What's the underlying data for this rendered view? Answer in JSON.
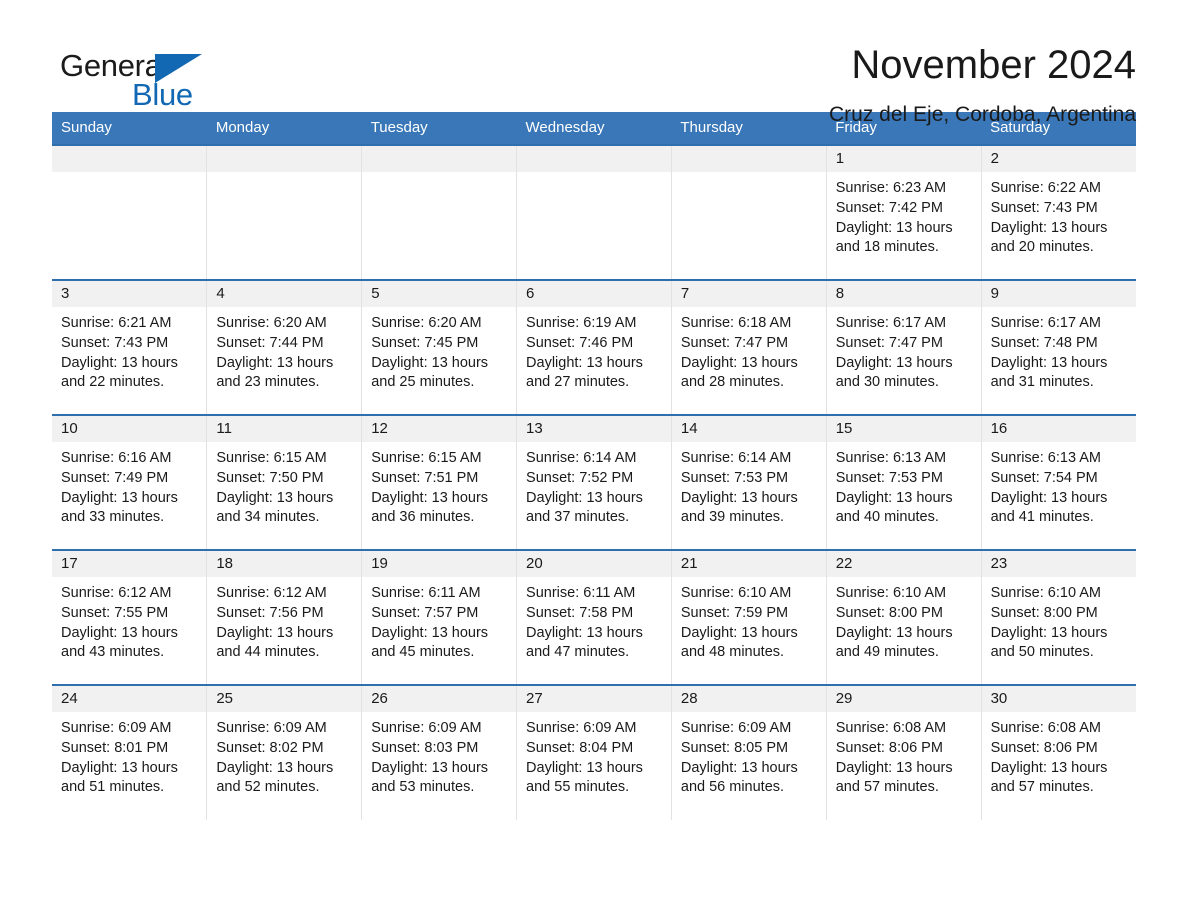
{
  "brand": {
    "name_part1": "General",
    "name_part2": "Blue",
    "accent_color": "#1268b3"
  },
  "header": {
    "month_title": "November 2024",
    "location": "Cruz del Eje, Cordoba, Argentina"
  },
  "calendar": {
    "header_bg": "#3a77b8",
    "row_divider_color": "#2f6fad",
    "weekdays": [
      "Sunday",
      "Monday",
      "Tuesday",
      "Wednesday",
      "Thursday",
      "Friday",
      "Saturday"
    ],
    "weeks": [
      [
        {
          "day": "",
          "lines": []
        },
        {
          "day": "",
          "lines": []
        },
        {
          "day": "",
          "lines": []
        },
        {
          "day": "",
          "lines": []
        },
        {
          "day": "",
          "lines": []
        },
        {
          "day": "1",
          "lines": [
            "Sunrise: 6:23 AM",
            "Sunset: 7:42 PM",
            "Daylight: 13 hours",
            "and 18 minutes."
          ]
        },
        {
          "day": "2",
          "lines": [
            "Sunrise: 6:22 AM",
            "Sunset: 7:43 PM",
            "Daylight: 13 hours",
            "and 20 minutes."
          ]
        }
      ],
      [
        {
          "day": "3",
          "lines": [
            "Sunrise: 6:21 AM",
            "Sunset: 7:43 PM",
            "Daylight: 13 hours",
            "and 22 minutes."
          ]
        },
        {
          "day": "4",
          "lines": [
            "Sunrise: 6:20 AM",
            "Sunset: 7:44 PM",
            "Daylight: 13 hours",
            "and 23 minutes."
          ]
        },
        {
          "day": "5",
          "lines": [
            "Sunrise: 6:20 AM",
            "Sunset: 7:45 PM",
            "Daylight: 13 hours",
            "and 25 minutes."
          ]
        },
        {
          "day": "6",
          "lines": [
            "Sunrise: 6:19 AM",
            "Sunset: 7:46 PM",
            "Daylight: 13 hours",
            "and 27 minutes."
          ]
        },
        {
          "day": "7",
          "lines": [
            "Sunrise: 6:18 AM",
            "Sunset: 7:47 PM",
            "Daylight: 13 hours",
            "and 28 minutes."
          ]
        },
        {
          "day": "8",
          "lines": [
            "Sunrise: 6:17 AM",
            "Sunset: 7:47 PM",
            "Daylight: 13 hours",
            "and 30 minutes."
          ]
        },
        {
          "day": "9",
          "lines": [
            "Sunrise: 6:17 AM",
            "Sunset: 7:48 PM",
            "Daylight: 13 hours",
            "and 31 minutes."
          ]
        }
      ],
      [
        {
          "day": "10",
          "lines": [
            "Sunrise: 6:16 AM",
            "Sunset: 7:49 PM",
            "Daylight: 13 hours",
            "and 33 minutes."
          ]
        },
        {
          "day": "11",
          "lines": [
            "Sunrise: 6:15 AM",
            "Sunset: 7:50 PM",
            "Daylight: 13 hours",
            "and 34 minutes."
          ]
        },
        {
          "day": "12",
          "lines": [
            "Sunrise: 6:15 AM",
            "Sunset: 7:51 PM",
            "Daylight: 13 hours",
            "and 36 minutes."
          ]
        },
        {
          "day": "13",
          "lines": [
            "Sunrise: 6:14 AM",
            "Sunset: 7:52 PM",
            "Daylight: 13 hours",
            "and 37 minutes."
          ]
        },
        {
          "day": "14",
          "lines": [
            "Sunrise: 6:14 AM",
            "Sunset: 7:53 PM",
            "Daylight: 13 hours",
            "and 39 minutes."
          ]
        },
        {
          "day": "15",
          "lines": [
            "Sunrise: 6:13 AM",
            "Sunset: 7:53 PM",
            "Daylight: 13 hours",
            "and 40 minutes."
          ]
        },
        {
          "day": "16",
          "lines": [
            "Sunrise: 6:13 AM",
            "Sunset: 7:54 PM",
            "Daylight: 13 hours",
            "and 41 minutes."
          ]
        }
      ],
      [
        {
          "day": "17",
          "lines": [
            "Sunrise: 6:12 AM",
            "Sunset: 7:55 PM",
            "Daylight: 13 hours",
            "and 43 minutes."
          ]
        },
        {
          "day": "18",
          "lines": [
            "Sunrise: 6:12 AM",
            "Sunset: 7:56 PM",
            "Daylight: 13 hours",
            "and 44 minutes."
          ]
        },
        {
          "day": "19",
          "lines": [
            "Sunrise: 6:11 AM",
            "Sunset: 7:57 PM",
            "Daylight: 13 hours",
            "and 45 minutes."
          ]
        },
        {
          "day": "20",
          "lines": [
            "Sunrise: 6:11 AM",
            "Sunset: 7:58 PM",
            "Daylight: 13 hours",
            "and 47 minutes."
          ]
        },
        {
          "day": "21",
          "lines": [
            "Sunrise: 6:10 AM",
            "Sunset: 7:59 PM",
            "Daylight: 13 hours",
            "and 48 minutes."
          ]
        },
        {
          "day": "22",
          "lines": [
            "Sunrise: 6:10 AM",
            "Sunset: 8:00 PM",
            "Daylight: 13 hours",
            "and 49 minutes."
          ]
        },
        {
          "day": "23",
          "lines": [
            "Sunrise: 6:10 AM",
            "Sunset: 8:00 PM",
            "Daylight: 13 hours",
            "and 50 minutes."
          ]
        }
      ],
      [
        {
          "day": "24",
          "lines": [
            "Sunrise: 6:09 AM",
            "Sunset: 8:01 PM",
            "Daylight: 13 hours",
            "and 51 minutes."
          ]
        },
        {
          "day": "25",
          "lines": [
            "Sunrise: 6:09 AM",
            "Sunset: 8:02 PM",
            "Daylight: 13 hours",
            "and 52 minutes."
          ]
        },
        {
          "day": "26",
          "lines": [
            "Sunrise: 6:09 AM",
            "Sunset: 8:03 PM",
            "Daylight: 13 hours",
            "and 53 minutes."
          ]
        },
        {
          "day": "27",
          "lines": [
            "Sunrise: 6:09 AM",
            "Sunset: 8:04 PM",
            "Daylight: 13 hours",
            "and 55 minutes."
          ]
        },
        {
          "day": "28",
          "lines": [
            "Sunrise: 6:09 AM",
            "Sunset: 8:05 PM",
            "Daylight: 13 hours",
            "and 56 minutes."
          ]
        },
        {
          "day": "29",
          "lines": [
            "Sunrise: 6:08 AM",
            "Sunset: 8:06 PM",
            "Daylight: 13 hours",
            "and 57 minutes."
          ]
        },
        {
          "day": "30",
          "lines": [
            "Sunrise: 6:08 AM",
            "Sunset: 8:06 PM",
            "Daylight: 13 hours",
            "and 57 minutes."
          ]
        }
      ]
    ]
  }
}
